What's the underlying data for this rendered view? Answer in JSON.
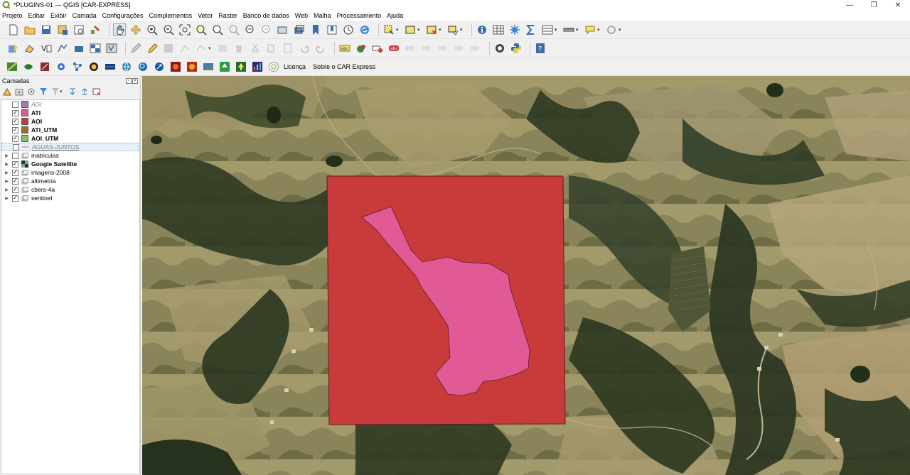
{
  "window": {
    "title": "*PLUGINS-01 — QGIS [CAR-EXPRESS]",
    "minimize": "—",
    "maximize": "❐",
    "close": "✕"
  },
  "menu": [
    "Projeto",
    "Editar",
    "Exibir",
    "Camada",
    "Configurações",
    "Complementos",
    "Vetor",
    "Raster",
    "Banco de dados",
    "Web",
    "Malha",
    "Processamento",
    "Ajuda"
  ],
  "plugin_toolbar": {
    "license_label": "Licença",
    "about_label": "Sobre o CAR Express"
  },
  "layers_panel": {
    "title": "Camadas",
    "layers": [
      {
        "name": "AGI",
        "checked": false,
        "type": "polygon",
        "color": "#a17cb3",
        "style": "italic",
        "expandable": false
      },
      {
        "name": "ATI",
        "checked": true,
        "type": "polygon",
        "color": "#e25a95",
        "style": "bold",
        "expandable": false
      },
      {
        "name": "AOI",
        "checked": true,
        "type": "polygon",
        "color": "#c93a3a",
        "style": "bold",
        "expandable": false
      },
      {
        "name": "ATI_UTM",
        "checked": true,
        "type": "polygon",
        "color": "#9c6b33",
        "style": "bold",
        "expandable": false
      },
      {
        "name": "AOI_UTM",
        "checked": true,
        "type": "polygon",
        "color": "#86c16c",
        "style": "bold",
        "expandable": false
      },
      {
        "name": "AGUAS-JUNTOS",
        "checked": false,
        "type": "line",
        "color": "#e7a5b3",
        "style": "italic-underline",
        "expandable": false
      },
      {
        "name": "matriculas",
        "checked": false,
        "type": "group",
        "color": "",
        "style": "normal",
        "expandable": true
      },
      {
        "name": "Google Satellite",
        "checked": true,
        "type": "raster-web",
        "color": "",
        "style": "bold",
        "expandable": true
      },
      {
        "name": "imagens-2008",
        "checked": true,
        "type": "group",
        "color": "",
        "style": "normal",
        "expandable": true
      },
      {
        "name": "altimetria",
        "checked": true,
        "type": "group",
        "color": "",
        "style": "normal",
        "expandable": true
      },
      {
        "name": "cbers-4a",
        "checked": true,
        "type": "group",
        "color": "",
        "style": "normal",
        "expandable": true
      },
      {
        "name": "sentinel",
        "checked": true,
        "type": "group",
        "color": "",
        "style": "normal",
        "expandable": true
      }
    ]
  },
  "map": {
    "aoi_fill": "#c93a3a",
    "ati_fill": "#e25a95",
    "stroke": "#5a2020"
  }
}
